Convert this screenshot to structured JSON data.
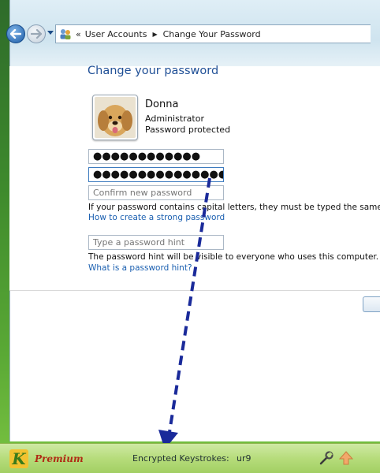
{
  "breadcrumb": {
    "items": [
      "User Accounts",
      "Change Your Password"
    ]
  },
  "page": {
    "title": "Change your password"
  },
  "user": {
    "name": "Donna",
    "role": "Administrator",
    "status": "Password protected"
  },
  "fields": {
    "current_password": "●●●●●●●●●●●●",
    "new_password": "●●●●●●●●●●●●●●●●●●●●",
    "confirm_placeholder": "Confirm new password",
    "hint_placeholder": "Type a password hint"
  },
  "notes": {
    "caps": "If your password contains capital letters, they must be typed the same wa",
    "strong_link": "How to create a strong password",
    "hint_note": "The password hint will be visible to everyone who uses this computer.",
    "hint_link": "What is a password hint?"
  },
  "statusbar": {
    "logo_letter": "K",
    "product": "Premium",
    "label": "Encrypted Keystrokes:",
    "value": "ur9"
  },
  "icons": {
    "back": "back-arrow-icon",
    "forward": "forward-arrow-icon",
    "user_accounts": "user-accounts-icon",
    "tools": "wrench-icon",
    "up": "up-arrow-icon"
  },
  "colors": {
    "heading": "#1f4f96",
    "link": "#1a5fb0",
    "annotation_arrow": "#1a2a9a",
    "statusbar": "#b6dc7b"
  }
}
